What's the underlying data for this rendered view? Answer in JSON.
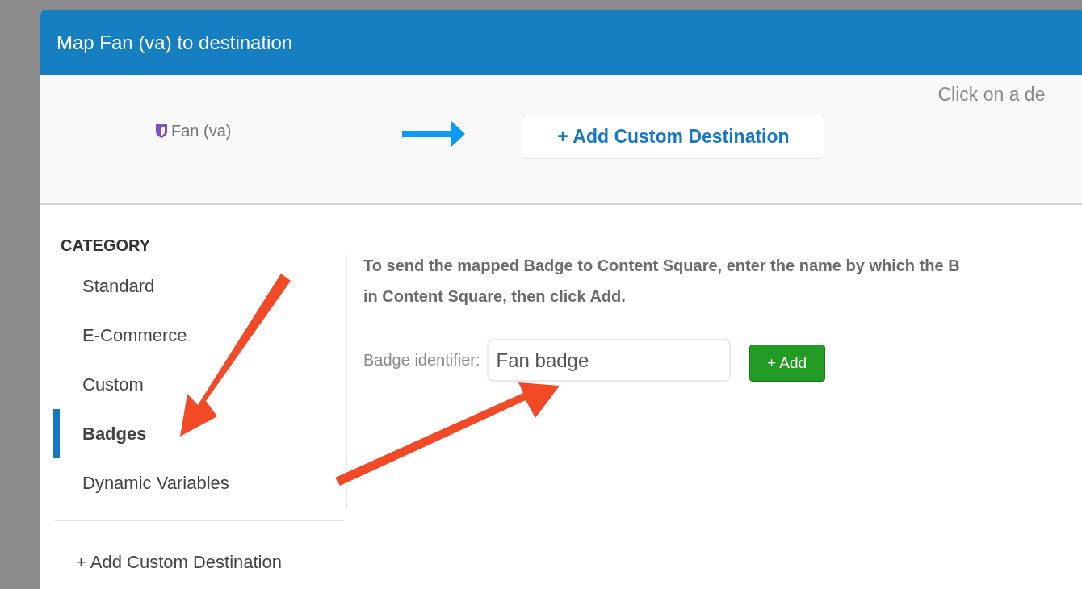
{
  "dialog": {
    "title": "Map Fan (va) to destination"
  },
  "mapping": {
    "source": "Fan (va)",
    "destination_button": "+ Add Custom Destination",
    "hint": "Click on a de"
  },
  "sidebar": {
    "heading": "CATEGORY",
    "items": [
      {
        "label": "Standard",
        "selected": false
      },
      {
        "label": "E-Commerce",
        "selected": false
      },
      {
        "label": "Custom",
        "selected": false
      },
      {
        "label": "Badges",
        "selected": true
      },
      {
        "label": "Dynamic Variables",
        "selected": false
      }
    ],
    "footer_link": "+ Add Custom Destination"
  },
  "content": {
    "instructions": [
      "To send the mapped Badge to Content Square, enter the name by which the B",
      "in Content Square, then click Add."
    ],
    "field_label": "Badge identifier:",
    "field_value": "Fan badge",
    "add_button": "+ Add"
  }
}
